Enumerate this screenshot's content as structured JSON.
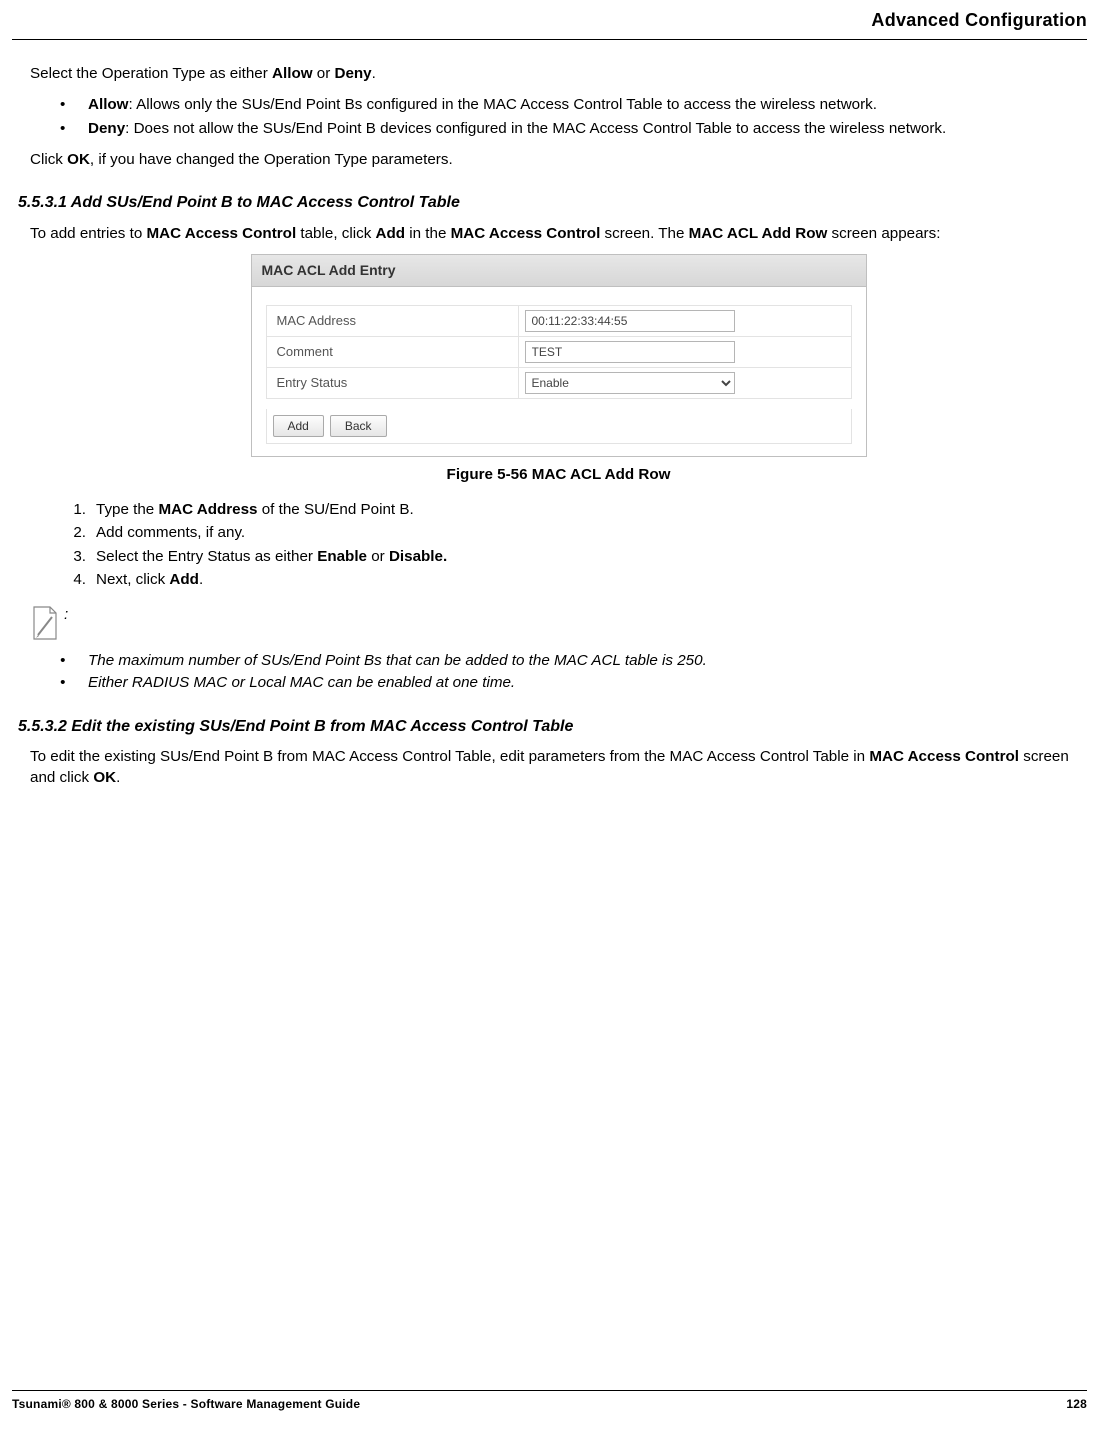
{
  "header": {
    "title": "Advanced Configuration"
  },
  "body": {
    "p1_a": "Select the Operation Type as either ",
    "p1_b": "Allow",
    "p1_c": " or ",
    "p1_d": "Deny",
    "p1_e": ".",
    "bullets1": [
      {
        "label": "Allow",
        "text": ": Allows only the SUs/End Point Bs configured in the MAC Access Control Table to access the wireless network."
      },
      {
        "label": "Deny",
        "text": ": Does not allow the SUs/End Point B devices configured in the MAC Access Control Table to access the wireless network."
      }
    ],
    "p2_a": "Click ",
    "p2_b": "OK",
    "p2_c": ", if you have changed the Operation Type parameters.",
    "sec1": "5.5.3.1 Add SUs/End Point B to MAC Access Control Table",
    "p3_a": "To add entries to ",
    "p3_b": "MAC Access Control",
    "p3_c": " table, click ",
    "p3_d": "Add",
    "p3_e": " in the ",
    "p3_f": "MAC Access Control",
    "p3_g": " screen. The ",
    "p3_h": "MAC ACL Add Row",
    "p3_i": " screen appears:",
    "figcap": "Figure 5-56 MAC ACL Add Row",
    "ol": [
      {
        "n": "1.",
        "a": "Type the ",
        "b": "MAC Address",
        "c": " of the SU/End Point B."
      },
      {
        "n": "2.",
        "a": "Add comments, if any.",
        "b": "",
        "c": ""
      },
      {
        "n": "3.",
        "a": "Select the Entry Status as either ",
        "b": "Enable",
        "c": " or ",
        "d": "Disable.",
        "e": ""
      },
      {
        "n": "4.",
        "a": "Next, click ",
        "b": "Add",
        "c": "."
      }
    ],
    "note_colon": ":",
    "note_bullets": [
      "The maximum number of SUs/End Point Bs that can be added to the MAC ACL table is 250.",
      "Either RADIUS MAC or Local MAC can be enabled at one time."
    ],
    "sec2": "5.5.3.2 Edit the existing SUs/End Point B from MAC Access Control Table",
    "p4_a": "To edit the existing SUs/End Point B from MAC Access Control Table, edit parameters from the MAC Access Control Table in ",
    "p4_b": "MAC Access Control",
    "p4_c": " screen and click ",
    "p4_d": "OK",
    "p4_e": "."
  },
  "dialog": {
    "title": "MAC ACL Add Entry",
    "rows": {
      "mac_label": "MAC Address",
      "mac_value": "00:11:22:33:44:55",
      "comment_label": "Comment",
      "comment_value": "TEST",
      "status_label": "Entry Status",
      "status_value": "Enable"
    },
    "buttons": {
      "add": "Add",
      "back": "Back"
    }
  },
  "footer": {
    "left": "Tsunami® 800 & 8000 Series - Software Management Guide",
    "right": "128"
  }
}
